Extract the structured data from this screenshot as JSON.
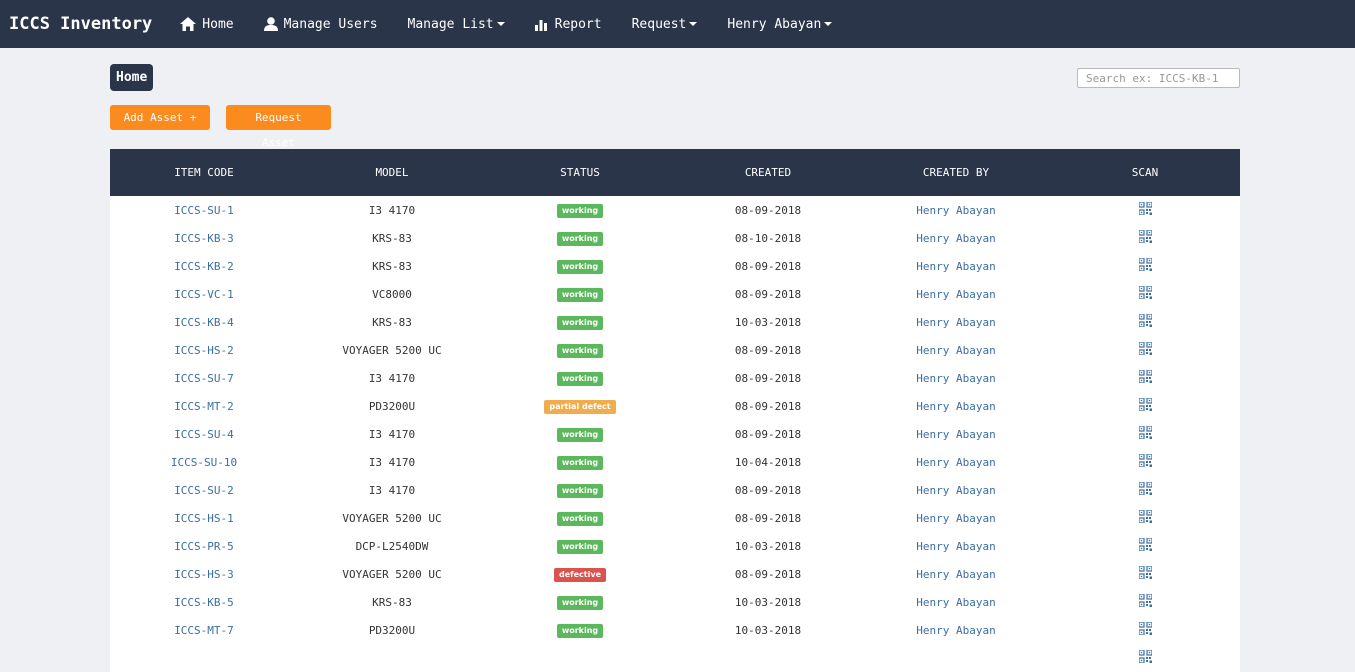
{
  "brand": "ICCS Inventory",
  "nav": {
    "home": "Home",
    "manage_users": "Manage Users",
    "manage_list": "Manage List",
    "report": "Report",
    "request": "Request",
    "user": "Henry Abayan"
  },
  "breadcrumb": "Home",
  "search": {
    "placeholder": "Search ex: ICCS-KB-1"
  },
  "buttons": {
    "add_asset": "Add Asset +",
    "request_asset": "Request Asset"
  },
  "table": {
    "headers": [
      "ITEM CODE",
      "MODEL",
      "STATUS",
      "CREATED",
      "CREATED BY",
      "SCAN"
    ],
    "rows": [
      {
        "code": "ICCS-SU-1",
        "model": "I3 4170",
        "status": "working",
        "created": "08-09-2018",
        "by": "Henry Abayan"
      },
      {
        "code": "ICCS-KB-3",
        "model": "KRS-83",
        "status": "working",
        "created": "08-10-2018",
        "by": "Henry Abayan"
      },
      {
        "code": "ICCS-KB-2",
        "model": "KRS-83",
        "status": "working",
        "created": "08-09-2018",
        "by": "Henry Abayan"
      },
      {
        "code": "ICCS-VC-1",
        "model": "VC8000",
        "status": "working",
        "created": "08-09-2018",
        "by": "Henry Abayan"
      },
      {
        "code": "ICCS-KB-4",
        "model": "KRS-83",
        "status": "working",
        "created": "10-03-2018",
        "by": "Henry Abayan"
      },
      {
        "code": "ICCS-HS-2",
        "model": "VOYAGER 5200 UC",
        "status": "working",
        "created": "08-09-2018",
        "by": "Henry Abayan"
      },
      {
        "code": "ICCS-SU-7",
        "model": "I3 4170",
        "status": "working",
        "created": "08-09-2018",
        "by": "Henry Abayan"
      },
      {
        "code": "ICCS-MT-2",
        "model": "PD3200U",
        "status": "partial defect",
        "created": "08-09-2018",
        "by": "Henry Abayan"
      },
      {
        "code": "ICCS-SU-4",
        "model": "I3 4170",
        "status": "working",
        "created": "08-09-2018",
        "by": "Henry Abayan"
      },
      {
        "code": "ICCS-SU-10",
        "model": "I3 4170",
        "status": "working",
        "created": "10-04-2018",
        "by": "Henry Abayan"
      },
      {
        "code": "ICCS-SU-2",
        "model": "I3 4170",
        "status": "working",
        "created": "08-09-2018",
        "by": "Henry Abayan"
      },
      {
        "code": "ICCS-HS-1",
        "model": "VOYAGER 5200 UC",
        "status": "working",
        "created": "08-09-2018",
        "by": "Henry Abayan"
      },
      {
        "code": "ICCS-PR-5",
        "model": "DCP-L2540DW",
        "status": "working",
        "created": "10-03-2018",
        "by": "Henry Abayan"
      },
      {
        "code": "ICCS-HS-3",
        "model": "VOYAGER 5200 UC",
        "status": "defective",
        "created": "08-09-2018",
        "by": "Henry Abayan"
      },
      {
        "code": "ICCS-KB-5",
        "model": "KRS-83",
        "status": "working",
        "created": "10-03-2018",
        "by": "Henry Abayan"
      },
      {
        "code": "ICCS-MT-7",
        "model": "PD3200U",
        "status": "working",
        "created": "10-03-2018",
        "by": "Henry Abayan"
      },
      {
        "code": "",
        "model": "",
        "status": "",
        "created": "",
        "by": ""
      }
    ]
  },
  "status_colors": {
    "working": "#5cb85c",
    "partial defect": "#f0ad4e",
    "defective": "#d9534f"
  },
  "colors": {
    "nav_bg": "#2a3549",
    "accent": "#fb8b1f",
    "link": "#3d6ea0"
  },
  "icons": {
    "home": "home-icon",
    "user": "user-icon",
    "report": "bar-chart-icon",
    "scan": "qrcode-icon"
  }
}
